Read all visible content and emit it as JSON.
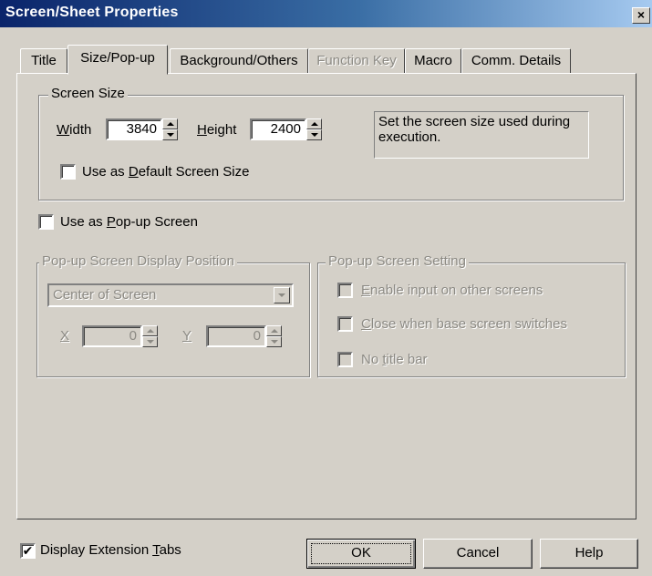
{
  "window": {
    "title": "Screen/Sheet Properties",
    "close_glyph": "×"
  },
  "tabs": [
    {
      "label": "Title",
      "state": "normal"
    },
    {
      "label": "Size/Pop-up",
      "state": "active"
    },
    {
      "label": "Background/Others",
      "state": "normal"
    },
    {
      "label": "Function Key",
      "state": "disabled"
    },
    {
      "label": "Macro",
      "state": "normal"
    },
    {
      "label": "Comm. Details",
      "state": "normal"
    }
  ],
  "screen_size": {
    "legend": "Screen Size",
    "width_label_mnemonic": "W",
    "width_label_rest": "idth",
    "width_value": "3840",
    "height_label_mnemonic": "H",
    "height_label_rest": "eight",
    "height_value": "2400",
    "hint": "Set the screen size used during execution.",
    "default_pre": "Use as ",
    "default_mnemonic": "D",
    "default_rest": "efault Screen Size",
    "default_checked": false
  },
  "popup": {
    "pre": "Use as ",
    "mnemonic": "P",
    "rest": "op-up Screen",
    "checked": false
  },
  "popup_position": {
    "legend": "Pop-up Screen Display Position",
    "selected": "Center of Screen",
    "x_label": "X",
    "x_value": "0",
    "y_label": "Y",
    "y_value": "0"
  },
  "popup_setting": {
    "legend": "Pop-up Screen Setting",
    "opt1_mnemonic": "E",
    "opt1_rest": "nable input on other screens",
    "opt2_mnemonic": "C",
    "opt2_rest": "lose when base screen switches",
    "opt3_pre": "No ",
    "opt3_mnemonic": "t",
    "opt3_rest": "itle bar"
  },
  "footer": {
    "ext_pre": "Display Extension ",
    "ext_mnemonic": "T",
    "ext_rest": "abs",
    "ext_checked": true,
    "check_glyph": "✔",
    "ok_label": "OK",
    "cancel_label": "Cancel",
    "help_label": "Help"
  }
}
